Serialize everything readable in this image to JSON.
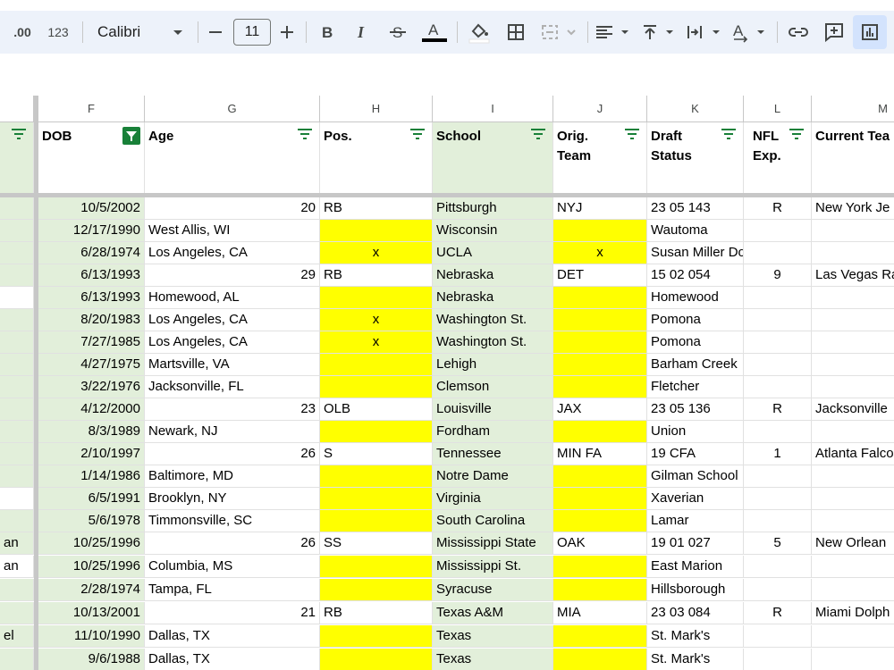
{
  "toolbar": {
    "decimal_increase": ".00",
    "number_format": "123",
    "font_family": "Calibri",
    "font_size": "11"
  },
  "columns": [
    {
      "letter": "",
      "header": ""
    },
    {
      "letter": "F",
      "header": "DOB"
    },
    {
      "letter": "G",
      "header": "Age"
    },
    {
      "letter": "H",
      "header": "Pos."
    },
    {
      "letter": "I",
      "header": "School"
    },
    {
      "letter": "J",
      "header": "Orig.\nTeam"
    },
    {
      "letter": "K",
      "header": "Draft\nStatus"
    },
    {
      "letter": "L",
      "header": "NFL\nExp."
    },
    {
      "letter": "M",
      "header": "Current Tea"
    }
  ],
  "rows": [
    {
      "e": "",
      "f": "10/5/2002",
      "g": "20",
      "h": "RB",
      "i": "Pittsburgh",
      "j": "NYJ",
      "k": "23 05 143",
      "l": "R",
      "m": "New York Je"
    },
    {
      "e": "",
      "f": "12/17/1990",
      "g": "West Allis,  WI",
      "h": "",
      "i": "Wisconsin",
      "j": "",
      "k": "Wautoma",
      "l": "",
      "m": ""
    },
    {
      "e": "",
      "f": "6/28/1974",
      "g": "Los Angeles,  CA",
      "h": "x",
      "i": "UCLA",
      "j": "x",
      "k": "Susan Miller Dorsey",
      "l": "",
      "m": ""
    },
    {
      "e": "",
      "f": "6/13/1993",
      "g": "29",
      "h": "RB",
      "i": "Nebraska",
      "j": "DET",
      "k": "15 02 054",
      "l": "9",
      "m": "Las Vegas Ra"
    },
    {
      "e": "",
      "f": "6/13/1993",
      "g": "Homewood,  AL",
      "h": "",
      "i": "Nebraska",
      "j": "",
      "k": "Homewood",
      "l": "",
      "m": ""
    },
    {
      "e": "",
      "f": "8/20/1983",
      "g": "Los Angeles,  CA",
      "h": "x",
      "i": "Washington St.",
      "j": "",
      "k": "Pomona",
      "l": "",
      "m": ""
    },
    {
      "e": "",
      "f": "7/27/1985",
      "g": "Los Angeles,  CA",
      "h": "x",
      "i": "Washington St.",
      "j": "",
      "k": "Pomona",
      "l": "",
      "m": ""
    },
    {
      "e": "",
      "f": "4/27/1975",
      "g": "Martsville,  VA",
      "h": "",
      "i": "Lehigh",
      "j": "",
      "k": "Barham Creek",
      "l": "",
      "m": ""
    },
    {
      "e": "",
      "f": "3/22/1976",
      "g": "Jacksonville,  FL",
      "h": "",
      "i": "Clemson",
      "j": "",
      "k": "Fletcher",
      "l": "",
      "m": ""
    },
    {
      "e": "",
      "f": "4/12/2000",
      "g": "23",
      "h": "OLB",
      "i": "Louisville",
      "j": "JAX",
      "k": "23 05 136",
      "l": "R",
      "m": "Jacksonville"
    },
    {
      "e": "",
      "f": "8/3/1989",
      "g": "Newark,  NJ",
      "h": "",
      "i": "Fordham",
      "j": "",
      "k": "Union",
      "l": "",
      "m": ""
    },
    {
      "e": "",
      "f": "2/10/1997",
      "g": "26",
      "h": "S",
      "i": "Tennessee",
      "j": "MIN FA",
      "k": "19 CFA",
      "l": "1",
      "m": "Atlanta Falco"
    },
    {
      "e": "",
      "f": "1/14/1986",
      "g": "Baltimore,  MD",
      "h": "",
      "i": "Notre Dame",
      "j": "",
      "k": "Gilman School",
      "l": "",
      "m": ""
    },
    {
      "e": "",
      "f": "6/5/1991",
      "g": "Brooklyn,  NY",
      "h": "",
      "i": "Virginia",
      "j": "",
      "k": "Xaverian",
      "l": "",
      "m": ""
    },
    {
      "e": "",
      "f": "5/6/1978",
      "g": "Timmonsville,  SC",
      "h": "",
      "i": "South Carolina",
      "j": "",
      "k": "Lamar",
      "l": "",
      "m": ""
    },
    {
      "e": "an",
      "f": "10/25/1996",
      "g": "26",
      "h": "SS",
      "i": "Mississippi State",
      "j": "OAK",
      "k": "19 01 027",
      "l": "5",
      "m": "New Orlean"
    },
    {
      "e": "an",
      "f": "10/25/1996",
      "g": "Columbia,  MS",
      "h": "",
      "i": "Mississippi St.",
      "j": "",
      "k": "East Marion",
      "l": "",
      "m": ""
    },
    {
      "e": "",
      "f": "2/28/1974",
      "g": "Tampa,  FL",
      "h": "",
      "i": "Syracuse",
      "j": "",
      "k": "Hillsborough",
      "l": "",
      "m": ""
    },
    {
      "e": "",
      "f": "10/13/2001",
      "g": "21",
      "h": "RB",
      "i": "Texas A&M",
      "j": "MIA",
      "k": "23 03 084",
      "l": "R",
      "m": "Miami Dolph"
    },
    {
      "e": "el",
      "f": "11/10/1990",
      "g": "Dallas,  TX",
      "h": "",
      "i": "Texas",
      "j": "",
      "k": "St. Mark's",
      "l": "",
      "m": ""
    },
    {
      "e": "",
      "f": "9/6/1988",
      "g": "Dallas,  TX",
      "h": "",
      "i": "Texas",
      "j": "",
      "k": "St. Mark's",
      "l": "",
      "m": ""
    }
  ],
  "colors": {
    "green_fill": "#e2efda",
    "yellow_fill": "#ffff00",
    "filter_active": "#188038",
    "toolbar_bg": "#edf2fa"
  },
  "icons": {
    "filter": "filter-icon",
    "filter_active": "filter-active-icon"
  }
}
